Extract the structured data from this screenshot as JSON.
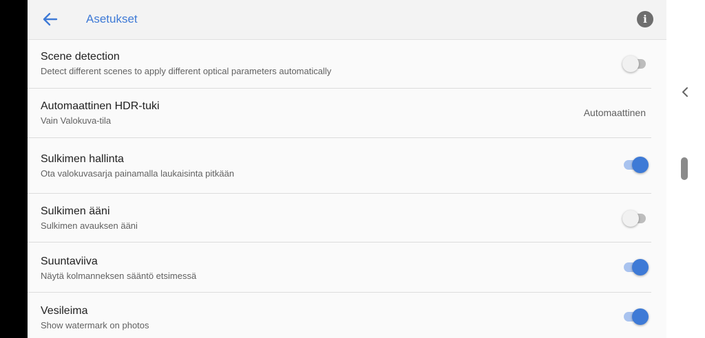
{
  "appbar": {
    "title": "Asetukset",
    "info_glyph": "i",
    "back_icon": "arrow-back-icon",
    "info_icon": "info-icon",
    "accent_color": "#3e7ad6"
  },
  "settings": [
    {
      "title": "Scene detection",
      "subtitle": "Detect different scenes to apply different optical parameters automatically",
      "toggle": "off"
    },
    {
      "title": "Automaattinen HDR-tuki",
      "subtitle": "Vain Valokuva-tila",
      "value": "Automaattinen"
    },
    {
      "title": "Sulkimen hallinta",
      "subtitle": "Ota valokuvasarja painamalla laukaisinta pitkään",
      "toggle": "on"
    },
    {
      "title": "Sulkimen ääni",
      "subtitle": "Sulkimen avauksen ääni",
      "toggle": "off"
    },
    {
      "title": "Suuntaviiva",
      "subtitle": "Näytä kolmanneksen sääntö etsimessä",
      "toggle": "on"
    },
    {
      "title": "Vesileima",
      "subtitle": "Show watermark on photos",
      "toggle": "on"
    }
  ],
  "side_panel": {
    "collapse_icon": "chevron-left-icon",
    "scroll_handle": "scroll-handle"
  }
}
